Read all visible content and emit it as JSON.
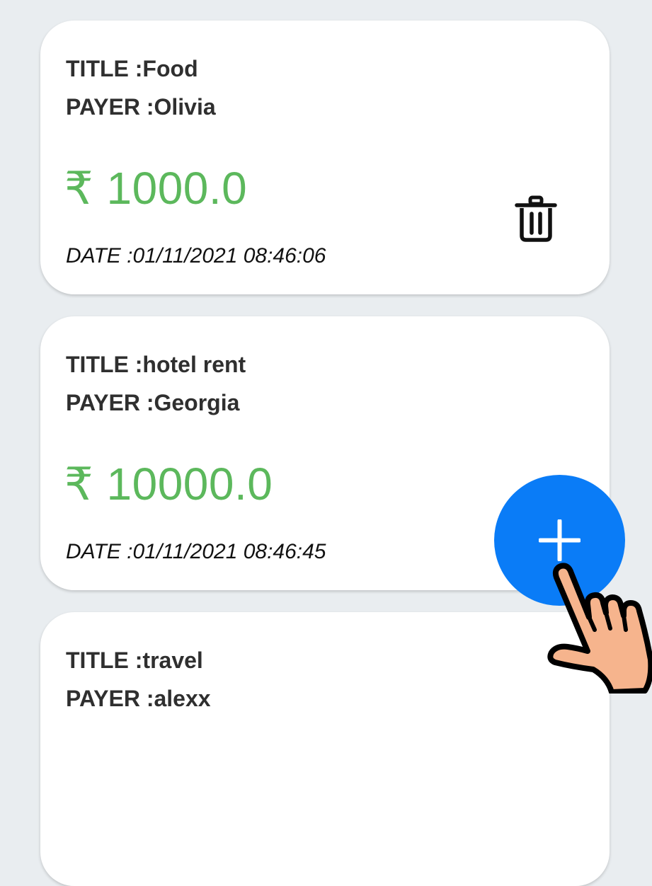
{
  "expenses": [
    {
      "title_label": "TITLE :",
      "title_value": "Food",
      "payer_label": "PAYER :",
      "payer_value": "Olivia",
      "amount": "₹ 1000.0",
      "date_label": "DATE :",
      "date_value": "01/11/2021 08:46:06",
      "delete_icon": "trash-icon"
    },
    {
      "title_label": "TITLE :",
      "title_value": "hotel rent",
      "payer_label": "PAYER :",
      "payer_value": "Georgia",
      "amount": "₹ 10000.0",
      "date_label": "DATE :",
      "date_value": "01/11/2021 08:46:45"
    },
    {
      "title_label": "TITLE :",
      "title_value": "travel",
      "payer_label": "PAYER :",
      "payer_value": "alexx"
    }
  ],
  "fab": {
    "icon": "plus-icon",
    "color": "#0a7cf7"
  },
  "colors": {
    "background": "#e9edf0",
    "amount": "#5cb85c",
    "card": "#ffffff"
  },
  "overlay": {
    "icon": "hand-pointer-icon"
  }
}
